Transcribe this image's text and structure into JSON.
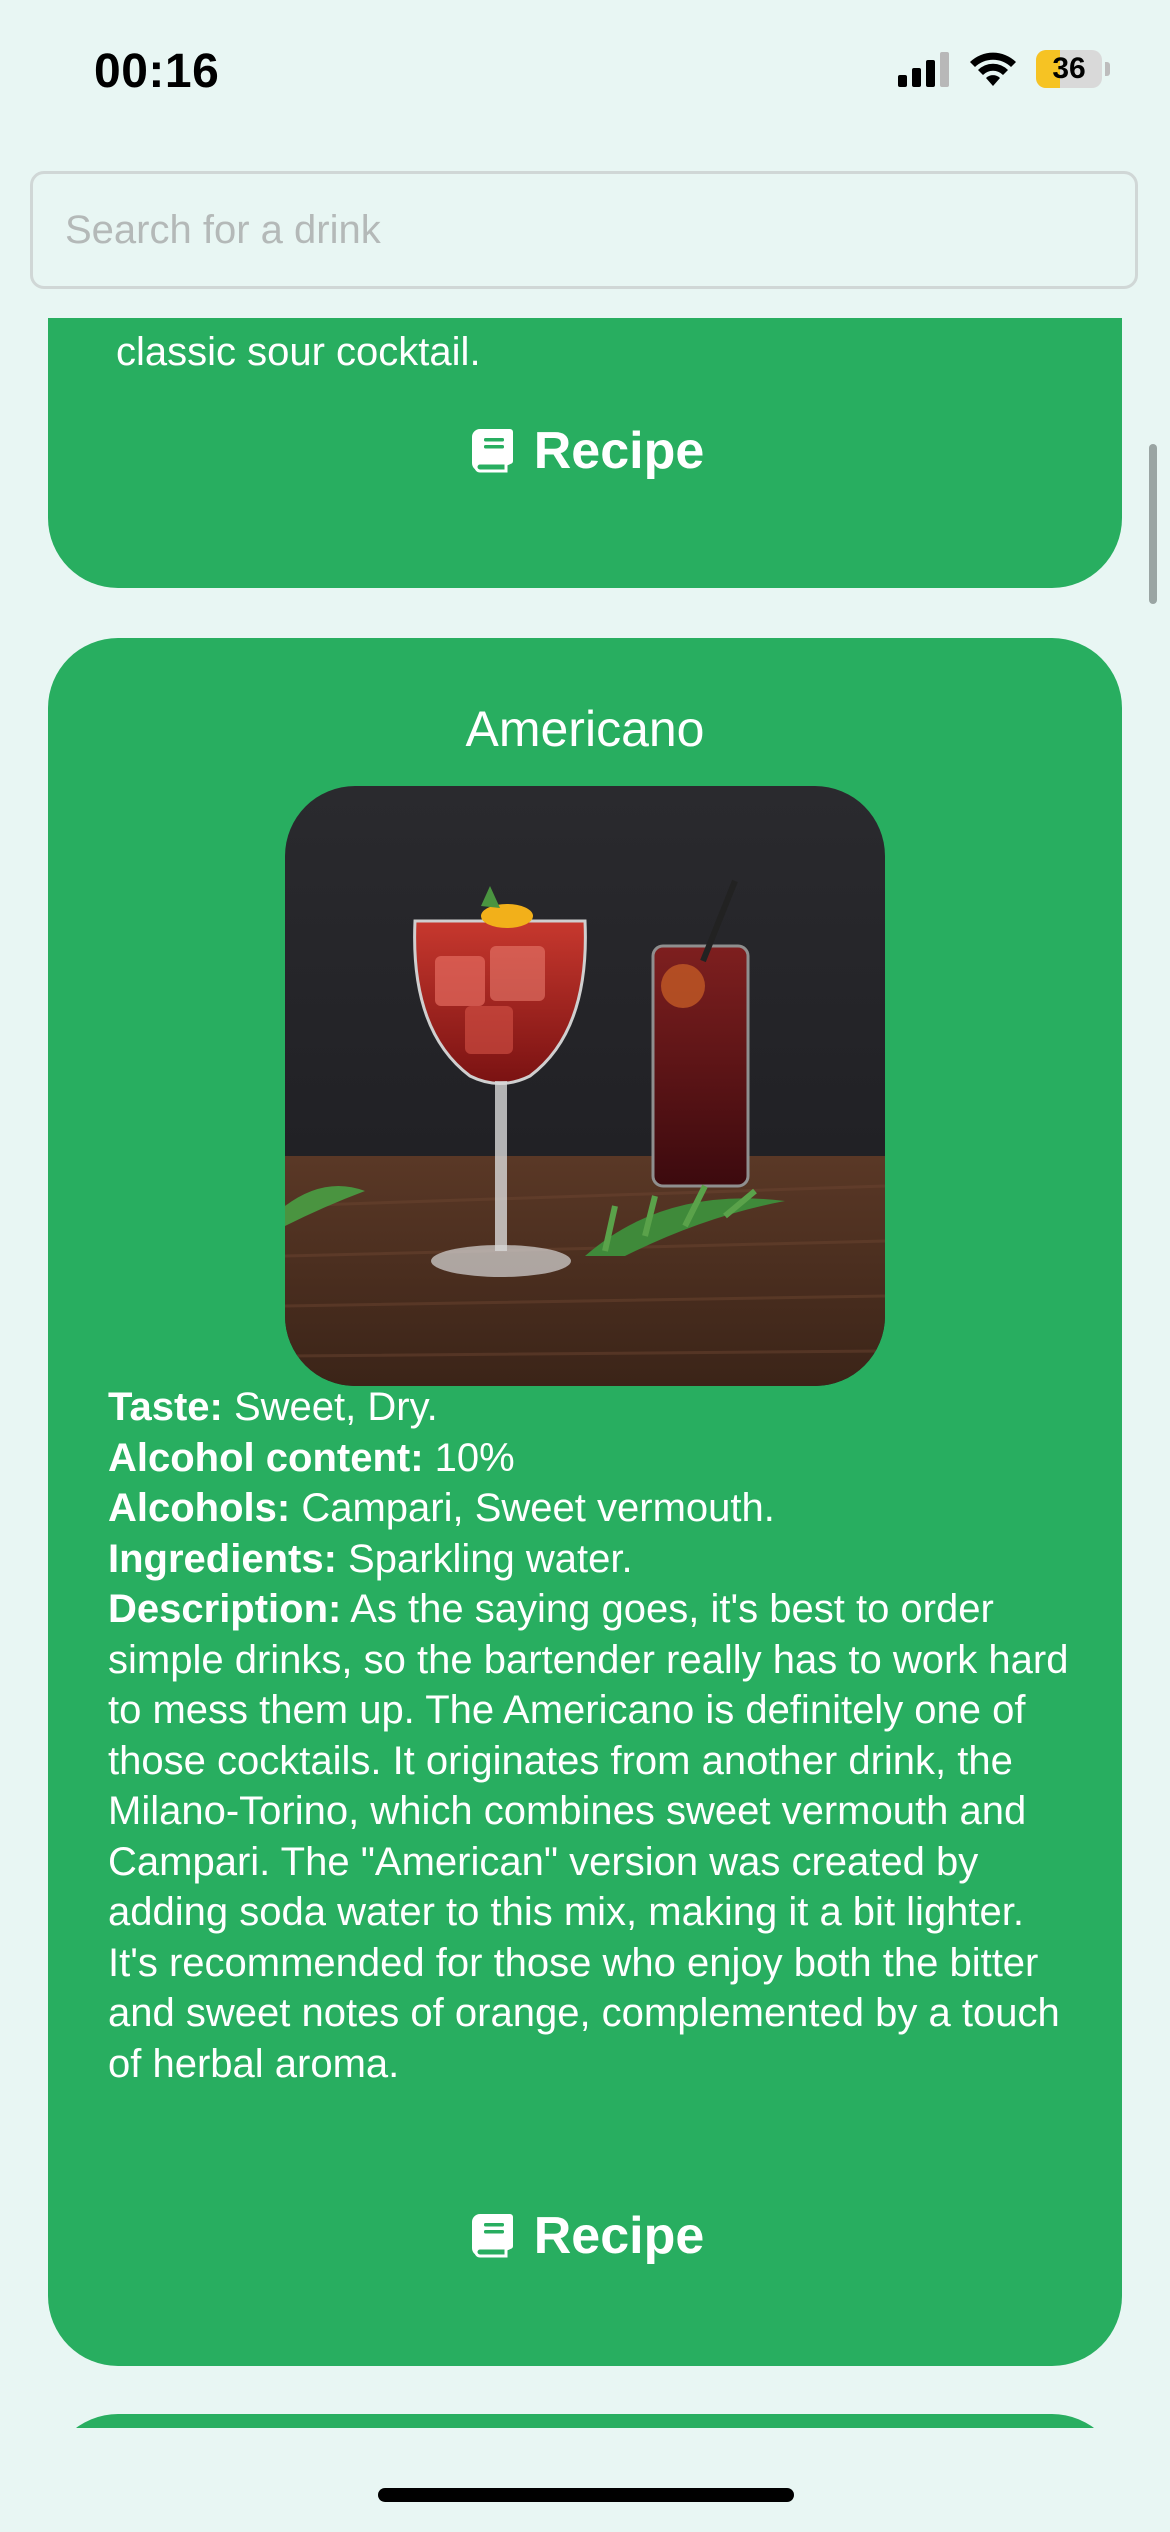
{
  "status_bar": {
    "time": "00:16",
    "battery": "36",
    "battery_level": 0.36,
    "battery_color": "#F6C323",
    "icons": [
      "cellular-signal-icon",
      "wifi-icon",
      "battery-icon"
    ]
  },
  "search": {
    "placeholder": "Search for a drink",
    "value": ""
  },
  "previous_card": {
    "description_tail": "classic sour cocktail.",
    "recipe_label": "Recipe",
    "recipe_icon": "book-icon"
  },
  "drink_card": {
    "title": "Americano",
    "image": "americano-cocktail-photo",
    "taste_label": "Taste:",
    "taste_value": " Sweet, Dry.",
    "alcohol_content_label": "Alcohol content:",
    "alcohol_content_value": " 10%",
    "alcohols_label": "Alcohols:",
    "alcohols_value": " Campari, Sweet vermouth.",
    "ingredients_label": "Ingredients:",
    "ingredients_value": " Sparkling water.",
    "description_label": "Description:",
    "description_value": " As the saying goes, it's best to order simple drinks, so the bartender really has to work hard to mess them up. The Americano is definitely one of those cocktails. It originates from another drink, the Milano-Torino, which combines sweet vermouth and Campari. The \"American\" version was created by adding soda water to this mix, making it a bit lighter. It's recommended for those who enjoy both the bitter and sweet notes of orange, complemented by a touch of herbal aroma.",
    "recipe_label": "Recipe",
    "recipe_icon": "book-icon"
  },
  "colors": {
    "background": "#E8F6F3",
    "card": "#28AE60",
    "text": "#FFFFFF"
  }
}
